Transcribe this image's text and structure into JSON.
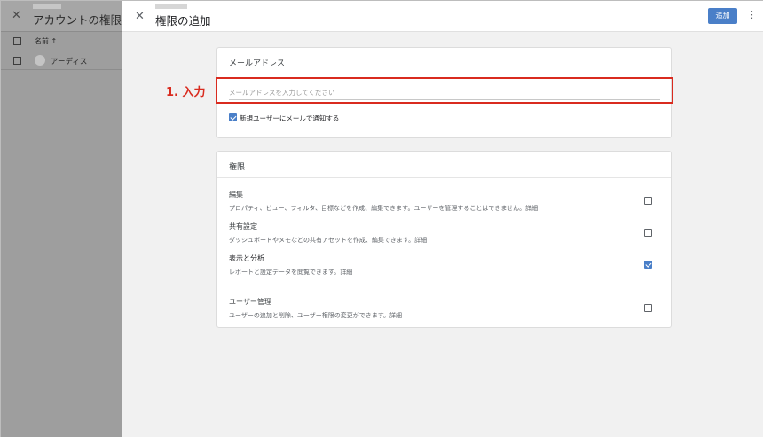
{
  "background": {
    "title": "アカウントの権限",
    "column_header": "名前 ↑",
    "row_user": "アーディス"
  },
  "dialog": {
    "title": "権限の追加",
    "add_button": "追加"
  },
  "email_section": {
    "heading": "メールアドレス",
    "input_placeholder": "メールアドレスを入力してください",
    "input_value": "",
    "notify_label": "新規ユーザーにメールで通知する",
    "notify_checked": true
  },
  "permissions_section": {
    "heading": "権限",
    "items": [
      {
        "name": "編集",
        "description": "プロパティ、ビュー、フィルタ、目標などを作成、編集できます。ユーザーを管理することはできません。",
        "detail": "詳細",
        "checked": false
      },
      {
        "name": "共有設定",
        "description": "ダッシュボードやメモなどの共有アセットを作成、編集できます。",
        "detail": "詳細",
        "checked": false
      },
      {
        "name": "表示と分析",
        "description": "レポートと設定データを閲覧できます。",
        "detail": "詳細",
        "checked": true
      },
      {
        "name": "ユーザー管理",
        "description": "ユーザーの追加と削除、ユーザー権限の変更ができます。",
        "detail": "詳細",
        "checked": false
      }
    ]
  },
  "annotation": {
    "label": "1. 入力",
    "color": "#d92b1f"
  },
  "colors": {
    "accent": "#4a7fc8",
    "annotation": "#d92b1f"
  }
}
